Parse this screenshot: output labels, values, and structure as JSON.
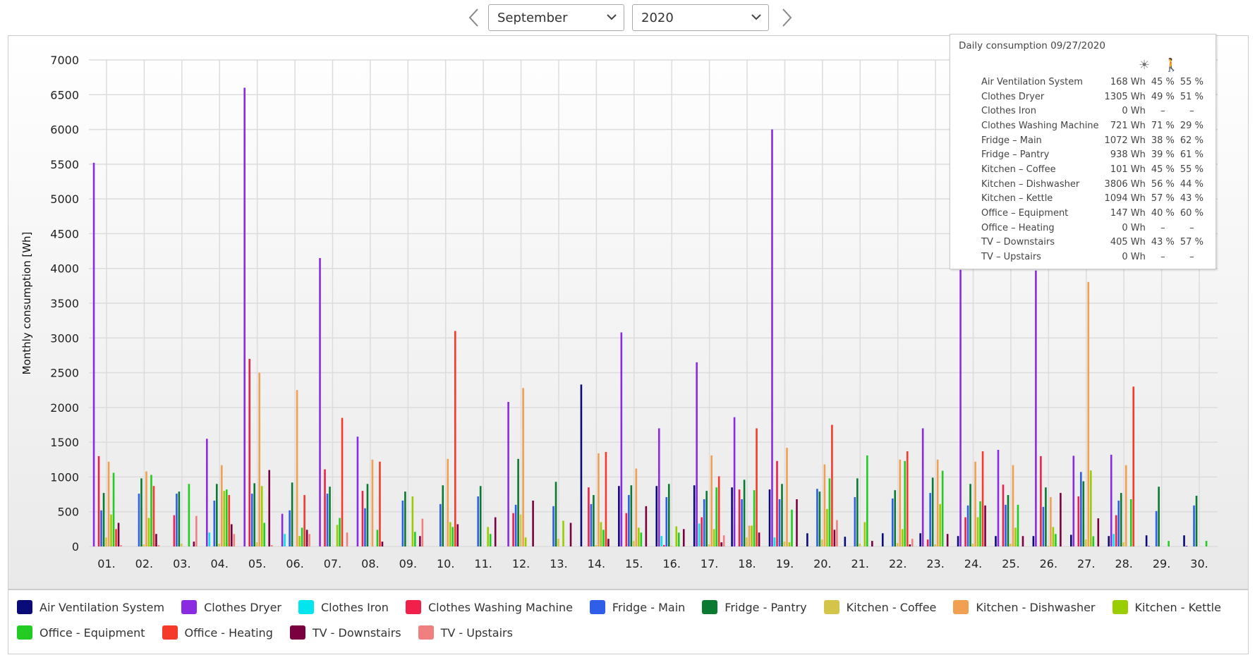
{
  "header": {
    "prev_icon": "chevron-left-icon",
    "next_icon": "chevron-right-icon",
    "month": "September",
    "year": "2020"
  },
  "tooltip": {
    "title": "Daily consumption 09/27/2020",
    "icons": [
      "sun-icon",
      "person-icon"
    ],
    "rows": [
      {
        "name": "Air Ventilation System",
        "value": "168 Wh",
        "p1": "45 %",
        "p2": "55 %"
      },
      {
        "name": "Clothes Dryer",
        "value": "1305 Wh",
        "p1": "49 %",
        "p2": "51 %"
      },
      {
        "name": "Clothes Iron",
        "value": "0 Wh",
        "p1": "–",
        "p2": "–"
      },
      {
        "name": "Clothes Washing Machine",
        "value": "721 Wh",
        "p1": "71 %",
        "p2": "29 %"
      },
      {
        "name": "Fridge – Main",
        "value": "1072 Wh",
        "p1": "38 %",
        "p2": "62 %"
      },
      {
        "name": "Fridge – Pantry",
        "value": "938 Wh",
        "p1": "39 %",
        "p2": "61 %"
      },
      {
        "name": "Kitchen – Coffee",
        "value": "101 Wh",
        "p1": "45 %",
        "p2": "55 %"
      },
      {
        "name": "Kitchen – Dishwasher",
        "value": "3806 Wh",
        "p1": "56 %",
        "p2": "44 %"
      },
      {
        "name": "Kitchen – Kettle",
        "value": "1094 Wh",
        "p1": "57 %",
        "p2": "43 %"
      },
      {
        "name": "Office – Equipment",
        "value": "147 Wh",
        "p1": "40 %",
        "p2": "60 %"
      },
      {
        "name": "Office – Heating",
        "value": "0 Wh",
        "p1": "–",
        "p2": "–"
      },
      {
        "name": "TV – Downstairs",
        "value": "405 Wh",
        "p1": "43 %",
        "p2": "57 %"
      },
      {
        "name": "TV – Upstairs",
        "value": "0 Wh",
        "p1": "–",
        "p2": "–"
      }
    ]
  },
  "chart_data": {
    "type": "bar",
    "ylabel": "Monthly consumption [Wh]",
    "xlabel": "",
    "ylim": [
      0,
      7000
    ],
    "yticks": [
      0,
      500,
      1000,
      1500,
      2000,
      2500,
      3000,
      3500,
      4000,
      4500,
      5000,
      5500,
      6000,
      6500,
      7000
    ],
    "grid": true,
    "legend_placement": "bottom",
    "categories": [
      "01.",
      "02.",
      "03.",
      "04.",
      "05.",
      "06.",
      "07.",
      "08.",
      "09.",
      "10.",
      "11.",
      "12.",
      "13.",
      "14.",
      "15.",
      "16.",
      "17.",
      "18.",
      "19.",
      "20.",
      "21.",
      "22.",
      "23.",
      "24.",
      "25.",
      "26.",
      "27.",
      "28.",
      "29.",
      "30."
    ],
    "series": [
      {
        "name": "Air Ventilation System",
        "color": "#0a0a78",
        "values": [
          0,
          0,
          0,
          0,
          0,
          0,
          0,
          0,
          0,
          0,
          0,
          0,
          0,
          2330,
          870,
          870,
          880,
          850,
          820,
          190,
          140,
          190,
          190,
          150,
          150,
          150,
          168,
          150,
          160,
          160
        ]
      },
      {
        "name": "Clothes Dryer",
        "color": "#8a2be2",
        "values": [
          5520,
          0,
          0,
          1550,
          6600,
          470,
          4150,
          1580,
          0,
          0,
          0,
          2080,
          0,
          0,
          3080,
          1700,
          2650,
          1860,
          6000,
          0,
          0,
          0,
          1700,
          3980,
          1390,
          3970,
          1305,
          1320,
          10,
          10
        ]
      },
      {
        "name": "Clothes Iron",
        "color": "#00e5ee",
        "values": [
          0,
          0,
          0,
          200,
          0,
          180,
          0,
          0,
          0,
          0,
          0,
          0,
          0,
          0,
          0,
          150,
          330,
          0,
          130,
          0,
          0,
          0,
          0,
          0,
          0,
          0,
          0,
          180,
          0,
          0
        ]
      },
      {
        "name": "Clothes Washing Machine",
        "color": "#f0204a",
        "values": [
          1300,
          0,
          450,
          0,
          2700,
          0,
          1110,
          800,
          0,
          0,
          0,
          480,
          0,
          850,
          480,
          20,
          420,
          820,
          1230,
          0,
          0,
          0,
          100,
          420,
          890,
          1300,
          721,
          450,
          0,
          0
        ]
      },
      {
        "name": "Fridge - Main",
        "color": "#2f5fe8",
        "values": [
          520,
          760,
          760,
          660,
          760,
          520,
          760,
          550,
          660,
          610,
          720,
          600,
          580,
          610,
          740,
          710,
          680,
          680,
          680,
          830,
          710,
          690,
          770,
          590,
          600,
          570,
          1072,
          660,
          510,
          590
        ]
      },
      {
        "name": "Fridge - Pantry",
        "color": "#0a7a30",
        "values": [
          770,
          980,
          790,
          900,
          910,
          920,
          860,
          900,
          790,
          880,
          870,
          1260,
          930,
          740,
          880,
          900,
          800,
          960,
          900,
          790,
          980,
          810,
          990,
          900,
          740,
          850,
          938,
          770,
          860,
          730
        ]
      },
      {
        "name": "Kitchen - Coffee",
        "color": "#d4c44a",
        "values": [
          130,
          30,
          40,
          40,
          60,
          0,
          0,
          0,
          0,
          0,
          0,
          460,
          110,
          20,
          80,
          10,
          30,
          130,
          70,
          100,
          40,
          50,
          30,
          40,
          40,
          10,
          101,
          60,
          0,
          0
        ]
      },
      {
        "name": "Kitchen - Dishwasher",
        "color": "#f0a050",
        "values": [
          1220,
          1080,
          0,
          1170,
          2500,
          2250,
          0,
          1250,
          0,
          1260,
          0,
          2280,
          0,
          1340,
          1120,
          0,
          1310,
          300,
          1420,
          1180,
          0,
          1250,
          1250,
          1220,
          1170,
          710,
          3806,
          1170,
          0,
          0
        ]
      },
      {
        "name": "Kitchen - Kettle",
        "color": "#9acd00",
        "values": [
          460,
          410,
          0,
          800,
          870,
          150,
          310,
          0,
          720,
          350,
          280,
          130,
          370,
          350,
          270,
          290,
          250,
          300,
          60,
          540,
          350,
          250,
          610,
          420,
          270,
          280,
          1094,
          0,
          0,
          0
        ]
      },
      {
        "name": "Office - Equipment",
        "color": "#22cc22",
        "values": [
          1060,
          1030,
          900,
          820,
          340,
          270,
          410,
          240,
          210,
          280,
          180,
          0,
          0,
          240,
          200,
          200,
          850,
          810,
          530,
          980,
          1310,
          1230,
          1090,
          650,
          600,
          180,
          147,
          680,
          80,
          80
        ]
      },
      {
        "name": "Office - Heating",
        "color": "#f53a2a",
        "values": [
          250,
          870,
          0,
          740,
          0,
          740,
          1850,
          1220,
          0,
          3100,
          0,
          0,
          0,
          1360,
          0,
          0,
          1010,
          1700,
          0,
          1750,
          0,
          1370,
          0,
          1370,
          0,
          0,
          0,
          2300,
          0,
          0
        ]
      },
      {
        "name": "TV - Downstairs",
        "color": "#7a0040",
        "values": [
          340,
          180,
          70,
          320,
          1100,
          240,
          0,
          70,
          150,
          320,
          420,
          660,
          340,
          110,
          580,
          250,
          60,
          200,
          680,
          240,
          80,
          30,
          180,
          590,
          150,
          770,
          405,
          0,
          0,
          0
        ]
      },
      {
        "name": "TV - Upstairs",
        "color": "#f08080",
        "values": [
          20,
          20,
          440,
          180,
          20,
          180,
          200,
          0,
          400,
          0,
          0,
          0,
          0,
          0,
          0,
          0,
          160,
          0,
          0,
          380,
          0,
          110,
          0,
          0,
          0,
          0,
          0,
          0,
          0,
          0
        ]
      }
    ]
  }
}
